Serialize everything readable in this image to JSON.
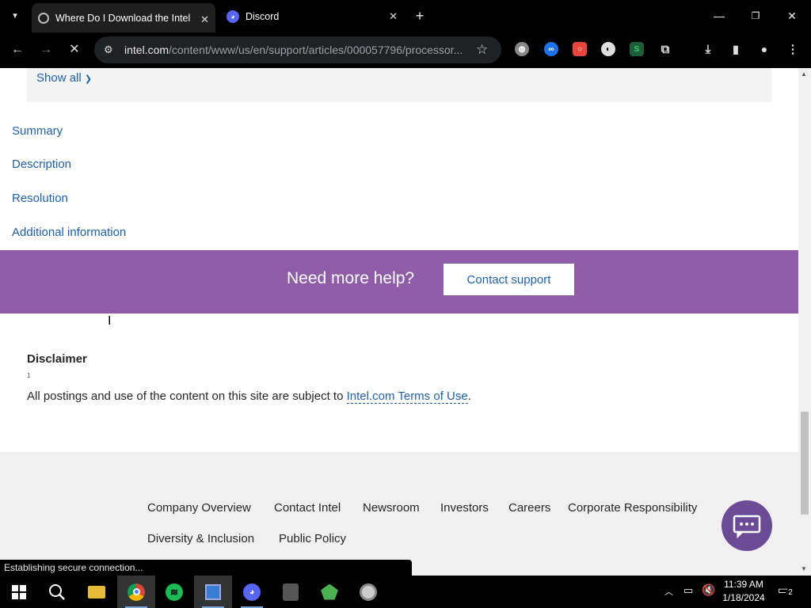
{
  "browser": {
    "tabs": [
      {
        "title": "Where Do I Download the Intel",
        "active": true
      },
      {
        "title": "Discord",
        "active": false
      }
    ],
    "url_host": "intel.com",
    "url_path": "/content/www/us/en/support/articles/000057796/processor...",
    "status": "Establishing secure connection..."
  },
  "page": {
    "show_all": "Show all",
    "toc": [
      "Summary",
      "Description",
      "Resolution",
      "Additional information"
    ],
    "help_title": "Need more help?",
    "contact_button": "Contact support",
    "disclaimer": {
      "title": "Disclaimer",
      "marker": "1",
      "text": "All postings and use of the content on this site are subject to ",
      "link": "Intel.com Terms of Use",
      "end": "."
    },
    "footer_links": [
      "Company Overview",
      "Contact Intel",
      "Newsroom",
      "Investors",
      "Careers",
      "Corporate Responsibility",
      "Diversity & Inclusion",
      "Public Policy"
    ]
  },
  "taskbar": {
    "time": "11:39 AM",
    "date": "1/18/2024",
    "notifications": "2"
  },
  "colors": {
    "link": "#1f60a8",
    "help_band": "#8f5da8",
    "chat_button": "#6b4b96"
  }
}
